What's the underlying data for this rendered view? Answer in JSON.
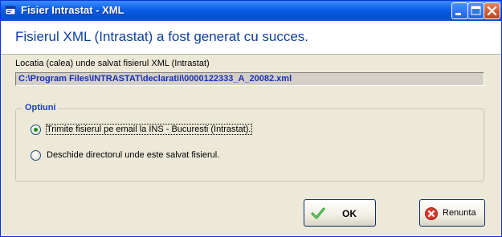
{
  "window": {
    "title": "Fisier Intrastat - XML",
    "buttons": [
      "minimize",
      "maximize",
      "close"
    ]
  },
  "header": {
    "title": "Fisierul XML (Intrastat) a fost generat cu succes."
  },
  "location": {
    "label": "Locatia (calea) unde salvat fisierul XML (Intrastat)",
    "path": "C:\\Program Files\\INTRASTAT\\declaratii\\0000122333_A_20082.xml"
  },
  "options": {
    "legend": "Optiuni",
    "items": [
      {
        "label": "Trimite fisierul pe email la INS - Bucuresti (Intrastat).",
        "selected": true
      },
      {
        "label": "Deschide directorul unde este salvat fisierul.",
        "selected": false
      }
    ]
  },
  "actions": {
    "ok_label": "OK",
    "cancel_label": "Renunta"
  },
  "colors": {
    "title_bar": "#0a5ee6",
    "header_text": "#1040a0",
    "path_text": "#1a2fb5",
    "legend_text": "#1a3fc8",
    "ok_check": "#2a9a2a",
    "cancel_icon": "#d93a2a"
  }
}
